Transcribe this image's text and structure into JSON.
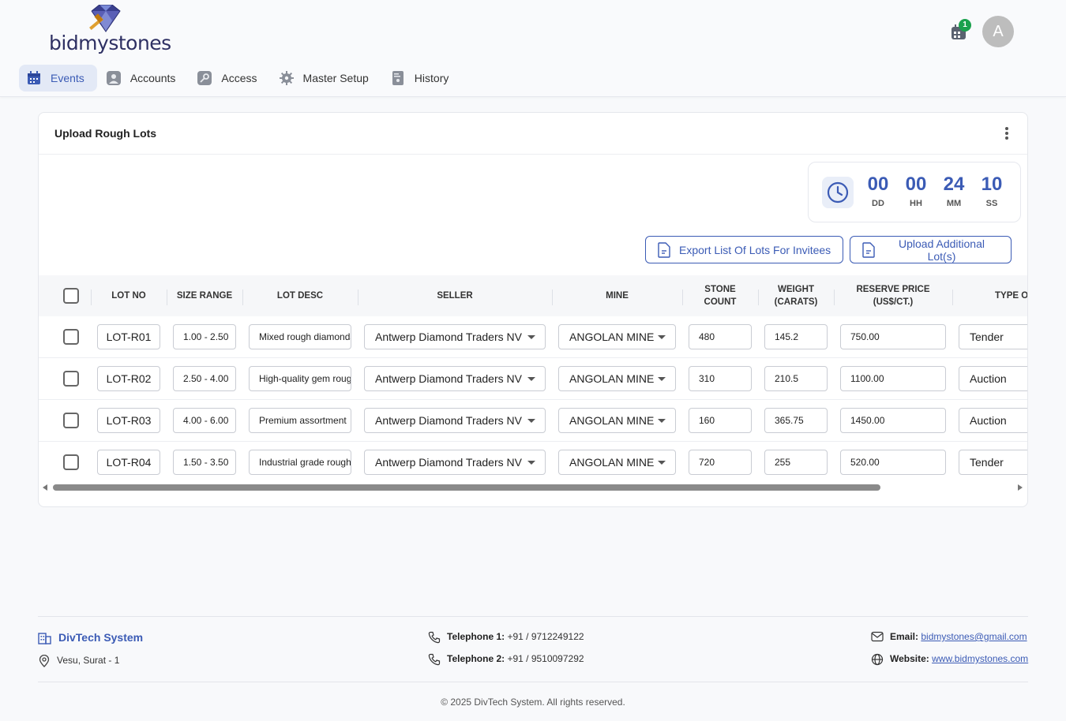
{
  "brand": {
    "logo_text": "bidmystones"
  },
  "header": {
    "notification_count": "1",
    "avatar_initial": "A"
  },
  "nav": [
    {
      "label": "Events",
      "icon": "calendar-icon",
      "active": true
    },
    {
      "label": "Accounts",
      "icon": "account-icon",
      "active": false
    },
    {
      "label": "Access",
      "icon": "key-icon",
      "active": false
    },
    {
      "label": "Master Setup",
      "icon": "gear-icon",
      "active": false
    },
    {
      "label": "History",
      "icon": "history-icon",
      "active": false
    }
  ],
  "card": {
    "title": "Upload Rough Lots"
  },
  "timer": {
    "days": "00",
    "hours": "00",
    "minutes": "24",
    "seconds": "10",
    "days_label": "DD",
    "hours_label": "HH",
    "minutes_label": "MM",
    "seconds_label": "SS"
  },
  "actions": {
    "export_label": "Export List Of Lots For Invitees",
    "upload_label": "Upload Additional Lot(s)"
  },
  "table": {
    "headers": {
      "lot_no": "LOT NO",
      "size_range": "SIZE RANGE",
      "lot_desc": "LOT DESC",
      "seller": "SELLER",
      "mine": "MINE",
      "stone_count_1": "STONE",
      "stone_count_2": "COUNT",
      "weight_1": "WEIGHT",
      "weight_2": "(CARATS)",
      "reserve_1": "RESERVE PRICE",
      "reserve_2": "(US$/CT.)",
      "type": "TYPE O"
    },
    "rows": [
      {
        "lot_no": "LOT-R01",
        "size_range": "1.00 - 2.50",
        "lot_desc": "Mixed rough diamonds",
        "seller": "Antwerp Diamond Traders NV",
        "mine": "ANGOLAN MINE",
        "stone_count": "480",
        "weight": "145.2",
        "reserve_price": "750.00",
        "type": "Tender"
      },
      {
        "lot_no": "LOT-R02",
        "size_range": "2.50 - 4.00",
        "lot_desc": "High-quality gem rough",
        "seller": "Antwerp Diamond Traders NV",
        "mine": "ANGOLAN MINE",
        "stone_count": "310",
        "weight": "210.5",
        "reserve_price": "1100.00",
        "type": "Auction"
      },
      {
        "lot_no": "LOT-R03",
        "size_range": "4.00 - 6.00",
        "lot_desc": "Premium assortment",
        "seller": "Antwerp Diamond Traders NV",
        "mine": "ANGOLAN MINE",
        "stone_count": "160",
        "weight": "365.75",
        "reserve_price": "1450.00",
        "type": "Auction"
      },
      {
        "lot_no": "LOT-R04",
        "size_range": "1.50 - 3.50",
        "lot_desc": "Industrial grade rough",
        "seller": "Antwerp Diamond Traders NV",
        "mine": "ANGOLAN MINE",
        "stone_count": "720",
        "weight": "255",
        "reserve_price": "520.00",
        "type": "Tender"
      }
    ]
  },
  "footer": {
    "company": "DivTech System",
    "address": "Vesu, Surat - 1",
    "tel1_label": "Telephone 1:",
    "tel1_value": " +91 / 9712249122",
    "tel2_label": "Telephone 2:",
    "tel2_value": " +91 / 9510097292",
    "email_label": "Email:",
    "email_value": "bidmystones@gmail.com",
    "website_label": "Website:",
    "website_value": "www.bidmystones.com",
    "copyright": "© 2025 DivTech System. All rights reserved."
  },
  "colors": {
    "accent": "#3b5bb5",
    "badge": "#1aa14d",
    "nav_active_bg": "#e3e9f6"
  }
}
